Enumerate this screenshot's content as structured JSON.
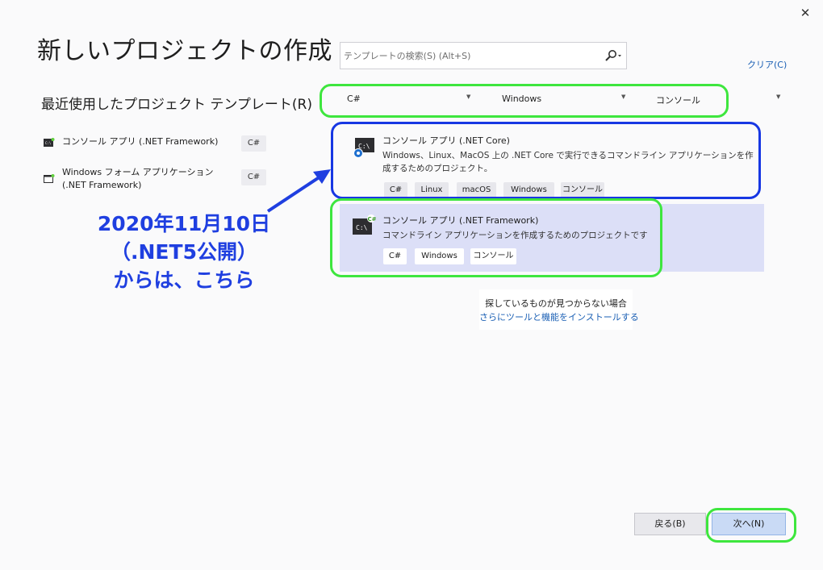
{
  "window": {
    "close_glyph": "✕"
  },
  "header": {
    "title": "新しいプロジェクトの作成"
  },
  "search": {
    "placeholder": "テンプレートの検索(S) (Alt+S)",
    "value": ""
  },
  "clear_label": "クリア(C)",
  "recent": {
    "heading": "最近使用したプロジェクト テンプレート(R)",
    "items": [
      {
        "label": "コンソール アプリ (.NET Framework)",
        "lang": "C#"
      },
      {
        "label": "Windows フォーム アプリケーション (.NET Framework)",
        "lang": "C#"
      }
    ]
  },
  "filters": {
    "language": "C#",
    "platform": "Windows",
    "project_type": "コンソール"
  },
  "templates": [
    {
      "name": "コンソール アプリ (.NET Core)",
      "description": "Windows、Linux、MacOS 上の .NET Core で実行できるコマンドライン アプリケーションを作成するためのプロジェクト。",
      "tags": [
        "C#",
        "Linux",
        "macOS",
        "Windows",
        "コンソール"
      ]
    },
    {
      "name": "コンソール アプリ (.NET Framework)",
      "description": "コマンドライン アプリケーションを作成するためのプロジェクトです",
      "tags": [
        "C#",
        "Windows",
        "コンソール"
      ]
    }
  ],
  "help": {
    "text": "探しているものが見つからない場合",
    "link": "さらにツールと機能をインストールする"
  },
  "annotation": {
    "line1": "2020年11月10日",
    "line2": "（.NET5公開）",
    "line3": "からは、こちら",
    "color": "#1f3fe0"
  },
  "buttons": {
    "back": "戻る(B)",
    "next": "次へ(N)"
  },
  "colors": {
    "highlight_green": "#3ee63e",
    "highlight_blue": "#1737e3",
    "selected_row": "#dcdff7",
    "link": "#1a5fb4"
  }
}
